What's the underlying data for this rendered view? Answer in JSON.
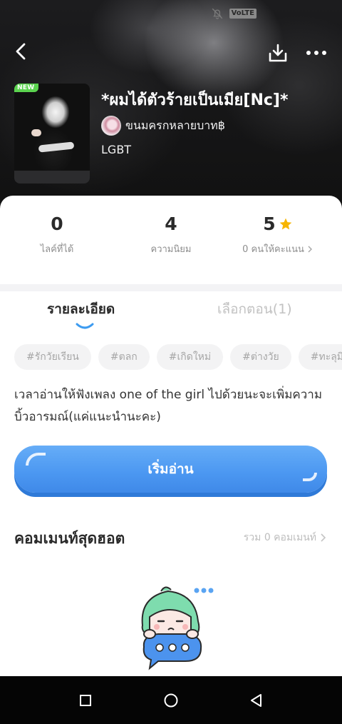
{
  "status_bar": {
    "volte": "VoLTE"
  },
  "header": {
    "back": "back-arrow-icon",
    "download": "download-icon",
    "more": "more-dots-icon"
  },
  "book": {
    "badge": "NEW",
    "title": "*ผมได้ตัวร้ายเป็นเมีย[Nc]*",
    "author": "ขนมครกหลายบาท฿",
    "genre": "LGBT"
  },
  "stats": [
    {
      "value": "0",
      "label": "ไลค์ที่ได้"
    },
    {
      "value": "4",
      "label": "ความนิยม"
    },
    {
      "value": "5",
      "label": "0 คนให้คะแนน"
    }
  ],
  "tabs": {
    "details": "รายละเอียด",
    "chapters": "เลือกตอน(1)"
  },
  "tags": [
    "#รักวัยเรียน",
    "#ตลก",
    "#เกิดใหม่",
    "#ต่างวัย",
    "#ทะลุมิติ"
  ],
  "description": "เวลาอ่านให้ฟังเพลง one of the girl ไปด้วยนะจะเพิ่มความบิ้วอารมณ์(แค่แนะนำนะคะ)",
  "read_button": "เริ่มอ่าน",
  "comments": {
    "title": "คอมเมนท์สุดฮอต",
    "total": "รวม 0 คอมเมนท์"
  },
  "colors": {
    "accent": "#4b97f1",
    "star": "#f7b500",
    "new_badge": "#5bd34f"
  }
}
